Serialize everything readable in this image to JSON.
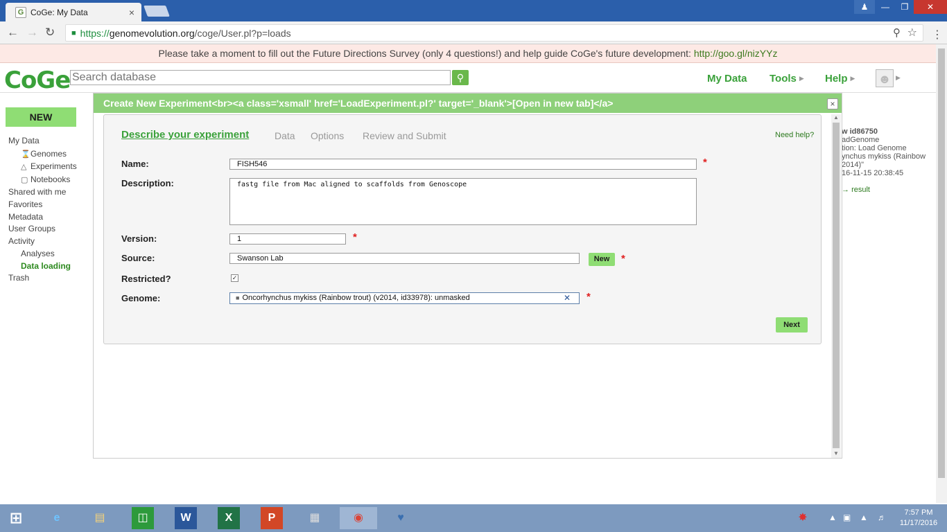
{
  "browser": {
    "tab_title": "CoGe: My Data",
    "tab_close": "×",
    "url_secure": "https://",
    "url_domain": "genomevolution.org",
    "url_path": "/coge/User.pl?p=loads"
  },
  "banner": {
    "text": "Please take a moment to fill out the Future Directions Survey (only 4 questions!) and help guide CoGe's future development: ",
    "link": "http://goo.gl/nizYYz"
  },
  "header": {
    "logo": "CoGe",
    "search_placeholder": "Search database",
    "nav": [
      "My Data",
      "Tools",
      "Help"
    ]
  },
  "sidebar": {
    "new_button": "NEW",
    "items": [
      {
        "label": "My Data"
      },
      {
        "label": "Genomes"
      },
      {
        "label": "Experiments"
      },
      {
        "label": "Notebooks"
      },
      {
        "label": "Shared with me"
      },
      {
        "label": "Favorites"
      },
      {
        "label": "Metadata"
      },
      {
        "label": "User Groups"
      },
      {
        "label": "Activity"
      },
      {
        "label": "Analyses"
      },
      {
        "label": "Data loading"
      },
      {
        "label": "Trash"
      }
    ]
  },
  "dialog": {
    "title": "Create New Experiment<br><a class='xsmall' href='LoadExperiment.pl?' target='_blank'>[Open in new tab]</a>",
    "close": "×",
    "steps": [
      "Describe your experiment",
      "Data",
      "Options",
      "Review and Submit"
    ],
    "need_help": "Need help?",
    "fields": {
      "name_label": "Name:",
      "name_value": "FISH546",
      "description_label": "Description:",
      "description_value": "fastg file from Mac aligned to scaffolds from Genoscope",
      "version_label": "Version:",
      "version_value": "1",
      "source_label": "Source:",
      "source_value": "Swanson Lab",
      "source_new_button": "New",
      "restricted_label": "Restricted?",
      "restricted_checked": true,
      "genome_label": "Genome:",
      "genome_value": "Oncorhynchus mykiss (Rainbow trout) (v2014, id33978): unmasked"
    },
    "next_button": "Next"
  },
  "right_panel": {
    "lines": [
      "w id86750",
      "adGenome",
      "tion: Load Genome",
      "ynchus mykiss (Rainbow",
      "2014)\"",
      "16-11-15 20:38:45"
    ],
    "link": "result"
  },
  "taskbar": {
    "time": "7:57 PM",
    "date": "11/17/2016"
  },
  "icons": {
    "lock": "lock-icon",
    "search": "search-icon",
    "star": "star-icon",
    "close": "close-icon"
  },
  "colors": {
    "brand_green": "#3aa13a",
    "button_green": "#8fdd74",
    "dialog_title_bg": "#8ed07a",
    "required_red": "#e02020"
  }
}
